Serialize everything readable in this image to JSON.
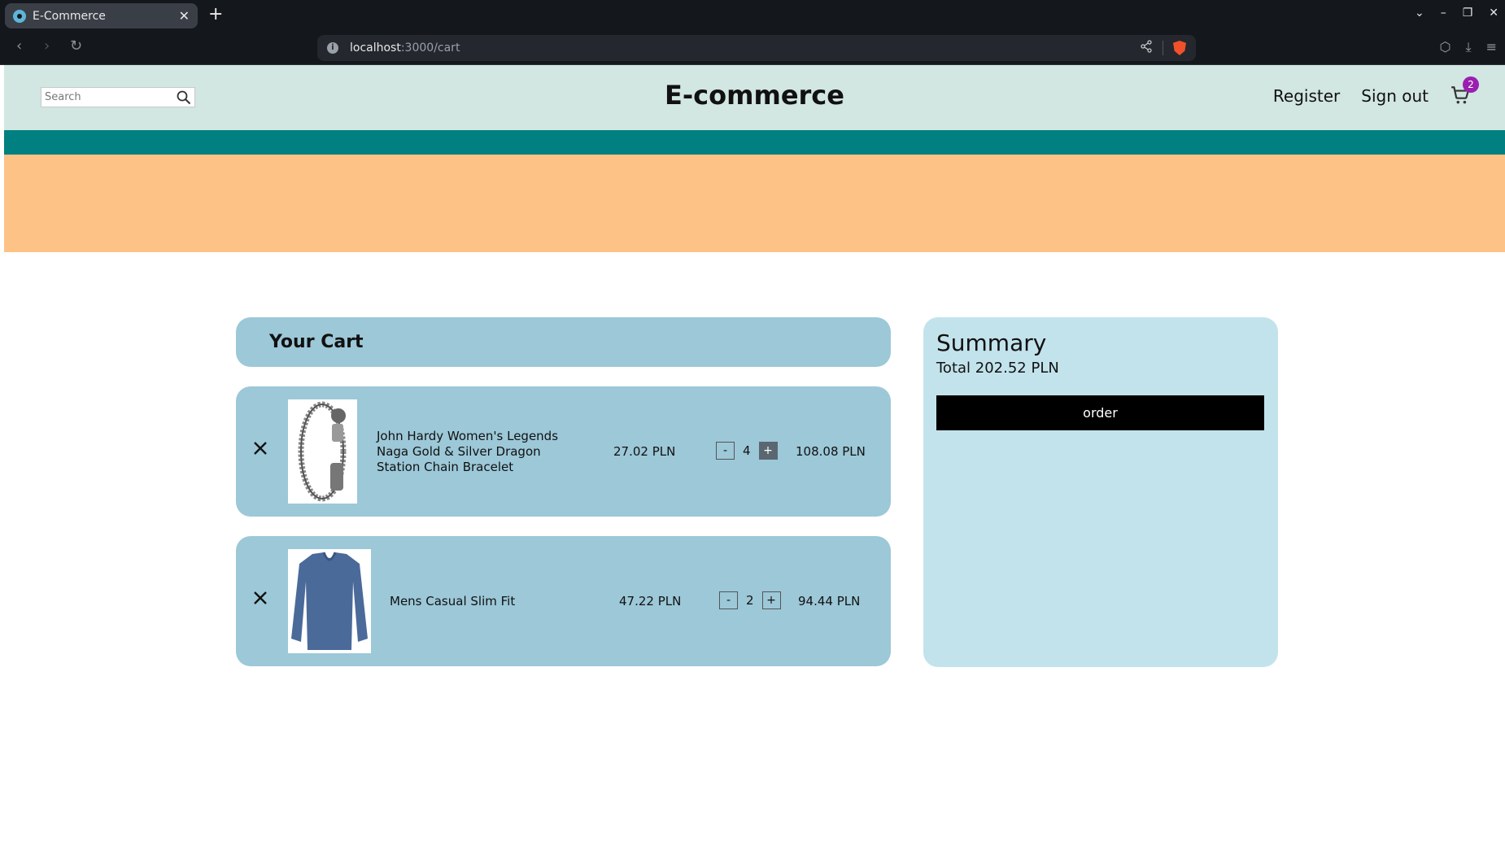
{
  "browser": {
    "tab_title": "E-Commerce",
    "url_host": "localhost",
    "url_path": ":3000/cart"
  },
  "header": {
    "search_placeholder": "Search",
    "brand": "E-commerce",
    "register": "Register",
    "sign_out": "Sign out",
    "cart_count": "2"
  },
  "cart": {
    "title": "Your Cart",
    "items": [
      {
        "name": "John Hardy Women's Legends Naga Gold & Silver Dragon Station Chain Bracelet",
        "price": "27.02 PLN",
        "quantity": "4",
        "minus": "-",
        "plus": "+",
        "total": "108.08 PLN"
      },
      {
        "name": "Mens Casual Slim Fit",
        "price": "47.22 PLN",
        "quantity": "2",
        "minus": "-",
        "plus": "+",
        "total": "94.44 PLN"
      }
    ]
  },
  "summary": {
    "title": "Summary",
    "total": "Total 202.52 PLN",
    "order_button": "order"
  },
  "colors": {
    "header_bg": "#d2e6e2",
    "teal": "#008080",
    "orange": "#fdc386",
    "cart_card": "#9cc8d8",
    "summary_card": "#c3e3ec",
    "badge": "#9a1fb0"
  }
}
